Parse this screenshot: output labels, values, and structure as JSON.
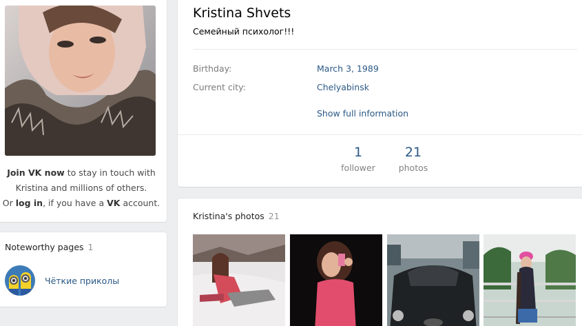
{
  "profile": {
    "name": "Kristina Shvets",
    "status": "Семейный психолог!!!",
    "info": [
      {
        "label": "Birthday:",
        "value": "March 3, 1989"
      },
      {
        "label": "Current city:",
        "value": "Chelyabinsk"
      }
    ],
    "show_full": "Show full information",
    "counters": {
      "followers": {
        "value": "1",
        "label": "follower"
      },
      "photos": {
        "value": "21",
        "label": "photos"
      }
    }
  },
  "join": {
    "join_link": "Join VK now",
    "line1_rest": " to stay in touch with",
    "line2": "Kristina and millions of others.",
    "or": "Or ",
    "login_link": "log in",
    "if_have": ", if you have a ",
    "vk": "VK",
    "account": " account."
  },
  "noteworthy": {
    "title": "Noteworthy pages",
    "count": "1",
    "items": [
      {
        "name": "Чёткие приколы",
        "icon": "minions-avatar"
      }
    ]
  },
  "photos": {
    "title": "Kristina's photos",
    "count": "21"
  },
  "colors": {
    "link": "#2a5885",
    "background": "#edeef0",
    "muted": "#828282"
  }
}
